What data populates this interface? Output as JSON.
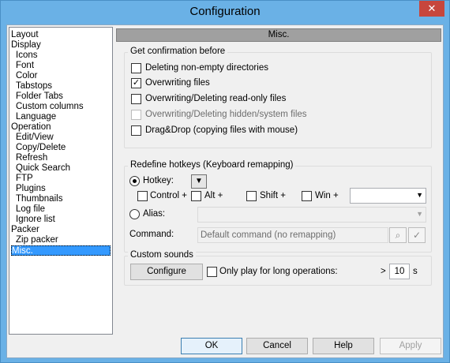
{
  "window": {
    "title": "Configuration",
    "close_glyph": "✕"
  },
  "tree": {
    "items": [
      {
        "label": "Layout",
        "level": 0
      },
      {
        "label": "Display",
        "level": 0
      },
      {
        "label": "Icons",
        "level": 1
      },
      {
        "label": "Font",
        "level": 1
      },
      {
        "label": "Color",
        "level": 1
      },
      {
        "label": "Tabstops",
        "level": 1
      },
      {
        "label": "Folder Tabs",
        "level": 1
      },
      {
        "label": "Custom columns",
        "level": 1
      },
      {
        "label": "Language",
        "level": 1
      },
      {
        "label": "Operation",
        "level": 0
      },
      {
        "label": "Edit/View",
        "level": 1
      },
      {
        "label": "Copy/Delete",
        "level": 1
      },
      {
        "label": "Refresh",
        "level": 1
      },
      {
        "label": "Quick Search",
        "level": 1
      },
      {
        "label": "FTP",
        "level": 1
      },
      {
        "label": "Plugins",
        "level": 1
      },
      {
        "label": "Thumbnails",
        "level": 1
      },
      {
        "label": "Log file",
        "level": 1
      },
      {
        "label": "Ignore list",
        "level": 1
      },
      {
        "label": "Packer",
        "level": 0
      },
      {
        "label": "Zip packer",
        "level": 1
      },
      {
        "label": "Misc.",
        "level": 0,
        "selected": true
      }
    ]
  },
  "panel": {
    "header": "Misc.",
    "confirm": {
      "title": "Get confirmation before",
      "options": [
        {
          "label": "Deleting non-empty directories",
          "checked": false,
          "enabled": true
        },
        {
          "label": "Overwriting files",
          "checked": true,
          "enabled": true
        },
        {
          "label": "Overwriting/Deleting read-only files",
          "checked": false,
          "enabled": true
        },
        {
          "label": "Overwriting/Deleting hidden/system files",
          "checked": false,
          "enabled": false
        },
        {
          "label": "Drag&Drop (copying files with mouse)",
          "checked": false,
          "enabled": true
        }
      ]
    },
    "hotkeys": {
      "title": "Redefine hotkeys (Keyboard remapping)",
      "hotkey_label": "Hotkey:",
      "control_label": "Control +",
      "alt_label": "Alt +",
      "shift_label": "Shift +",
      "win_label": "Win +",
      "alias_label": "Alias:",
      "command_label": "Command:",
      "command_value": "Default command (no remapping)"
    },
    "sounds": {
      "title": "Custom sounds",
      "configure_label": "Configure",
      "long_ops_label": "Only play for long operations:",
      "gt": ">",
      "seconds_value": "10",
      "seconds_unit": "s"
    }
  },
  "buttons": {
    "ok": "OK",
    "cancel": "Cancel",
    "help": "Help",
    "apply": "Apply"
  }
}
